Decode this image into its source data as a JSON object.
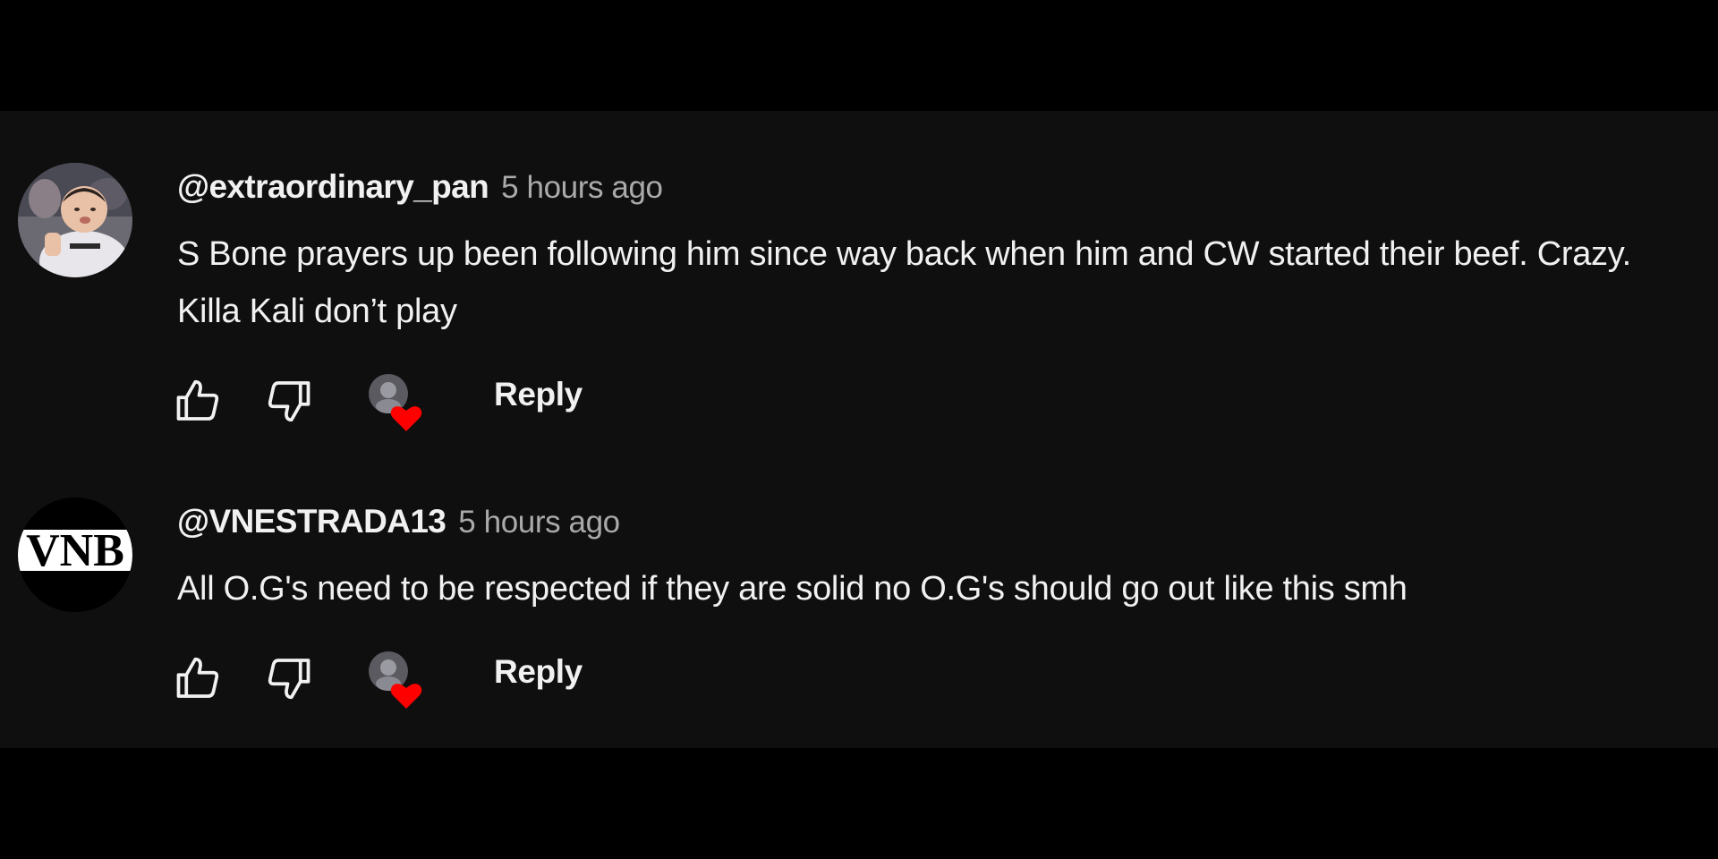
{
  "comments": [
    {
      "author": "@extraordinary_pan",
      "timestamp": "5 hours ago",
      "text": "S Bone prayers up been following him since way back when him and CW started their beef. Crazy. Killa Kali don’t play",
      "reply_label": "Reply",
      "avatar": "photo-avatar",
      "liked_by_creator": true
    },
    {
      "author": "@VNESTRADA13",
      "timestamp": "5 hours ago",
      "text": "All O.G's need to be respected if they are solid no O.G's should go out like this smh",
      "reply_label": "Reply",
      "avatar": "vnb-logo-avatar",
      "avatar_text": "VNB",
      "liked_by_creator": true
    }
  ],
  "icons": {
    "like": "thumbs-up-icon",
    "dislike": "thumbs-down-icon",
    "creator_heart": "creator-heart-icon"
  },
  "colors": {
    "background": "#0f0f0f",
    "letterbox": "#000000",
    "text": "#f1f1f1",
    "secondary_text": "#aaaaaa",
    "heart": "#ff0000"
  }
}
